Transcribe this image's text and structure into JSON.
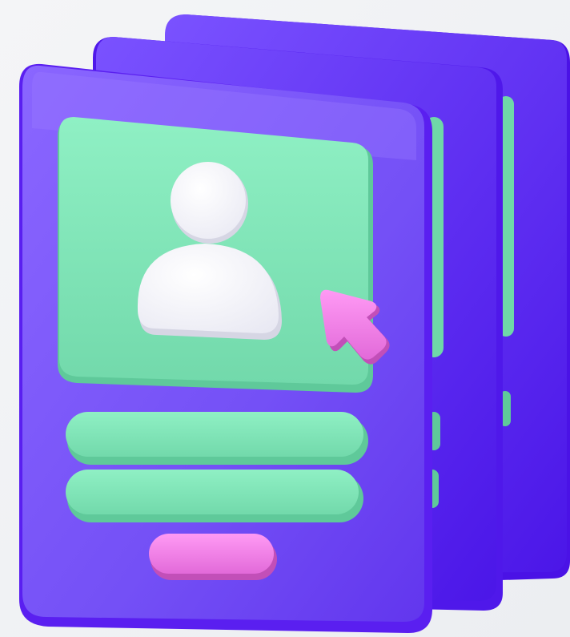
{
  "illustration": {
    "subject": "profile-card-stack",
    "card_count": 3,
    "icons": [
      "user-avatar-icon",
      "cursor-arrow-icon"
    ],
    "colors": {
      "background": "#f2f3f5",
      "card_front": "#7a55f7",
      "card_edge": "#5a1ff0",
      "card_back": "#6a3cf5",
      "photo_panel": "#7fe0b4",
      "photo_panel_shade": "#5fc99a",
      "avatar": "#ffffff",
      "text_line": "#7fe0b4",
      "action_button": "#f07ae8",
      "cursor": "#f07ae8"
    }
  }
}
